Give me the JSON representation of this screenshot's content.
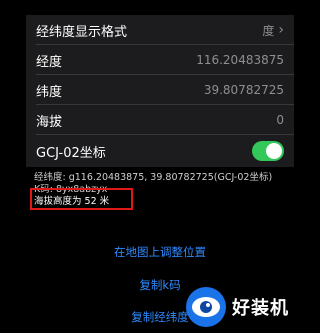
{
  "settings": {
    "format": {
      "label": "经纬度显示格式",
      "value": "度"
    },
    "longitude": {
      "label": "经度",
      "value": "116.20483875"
    },
    "latitude": {
      "label": "纬度",
      "value": "39.80782725"
    },
    "altitude": {
      "label": "海拔",
      "value": "0"
    },
    "gcj": {
      "label": "GCJ-02坐标",
      "enabled": true
    }
  },
  "info": {
    "coords_line": "经纬度: g116.20483875, 39.80782725(GCJ-02坐标)",
    "k_code_line": "K码: 8yx8abzyx",
    "altitude_line": "海拔高度为 52 米"
  },
  "actions": {
    "adjust_on_map": "在地图上调整位置",
    "copy_k_code": "复制k码",
    "copy_coords": "复制经纬度"
  },
  "watermark": {
    "text": "好装机"
  },
  "colors": {
    "accent": "#2f8bff",
    "toggle_on": "#34c759",
    "highlight": "#e01818"
  }
}
